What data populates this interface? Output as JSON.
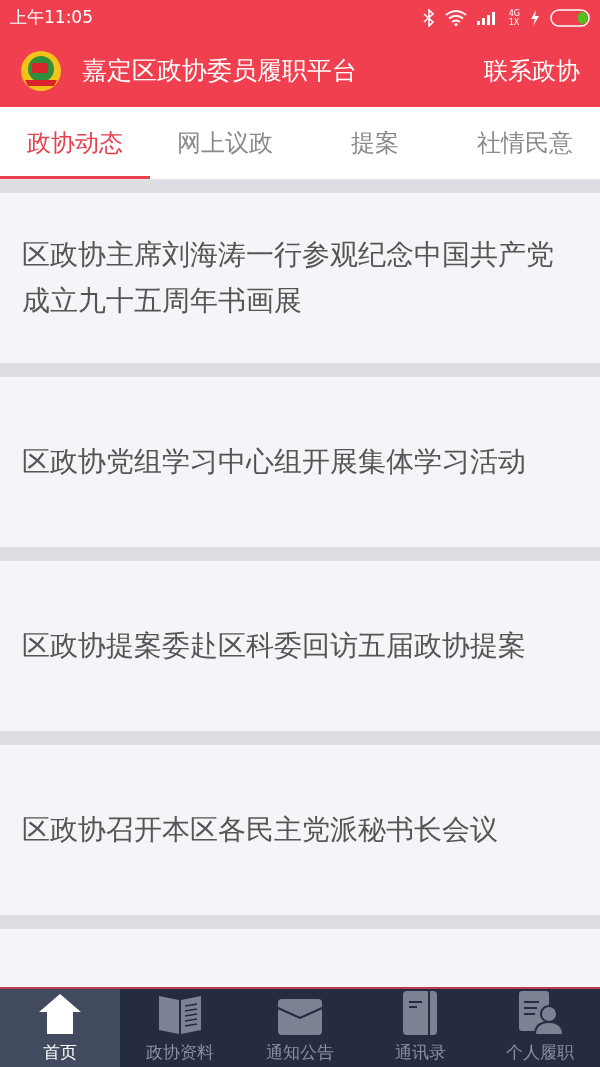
{
  "status_bar": {
    "time": "上午11:05",
    "network_top": "4G",
    "network_bottom": "1X"
  },
  "header": {
    "title": "嘉定区政协委员履职平台",
    "action": "联系政协"
  },
  "tabs": [
    {
      "label": "政协动态",
      "selected": true
    },
    {
      "label": "网上议政",
      "selected": false
    },
    {
      "label": "提案",
      "selected": false
    },
    {
      "label": "社情民意",
      "selected": false
    }
  ],
  "news": [
    {
      "title": "区政协主席刘海涛一行参观纪念中国共产党成立九十五周年书画展"
    },
    {
      "title": "区政协党组学习中心组开展集体学习活动"
    },
    {
      "title": "区政协提案委赴区科委回访五届政协提案"
    },
    {
      "title": "区政协召开本区各民主党派秘书长会议"
    }
  ],
  "bottom_nav": [
    {
      "label": "首页",
      "kind": "home",
      "selected": true
    },
    {
      "label": "政协资料",
      "kind": "book",
      "selected": false
    },
    {
      "label": "通知公告",
      "kind": "mail",
      "selected": false
    },
    {
      "label": "通讯录",
      "kind": "notebook",
      "selected": false
    },
    {
      "label": "个人履职",
      "kind": "profile",
      "selected": false
    }
  ]
}
